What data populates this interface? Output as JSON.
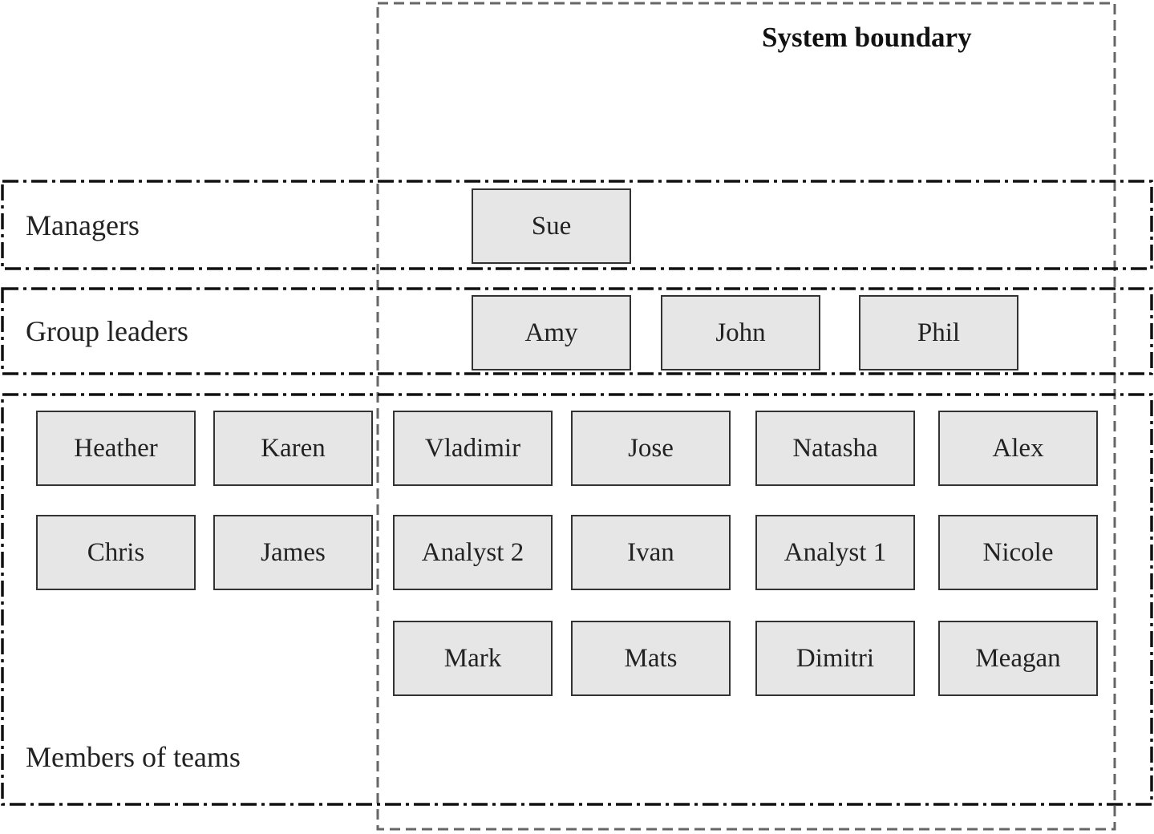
{
  "system_boundary": {
    "label": "System boundary",
    "line_color": "#666666"
  },
  "bands": [
    {
      "label": "Managers"
    },
    {
      "label": "Group leaders"
    },
    {
      "label": "Members of teams"
    }
  ],
  "managers": [
    "Sue"
  ],
  "group_leaders": [
    "Amy",
    "John",
    "Phil"
  ],
  "team_members_outside": [
    [
      "Heather",
      "Karen"
    ],
    [
      "Chris",
      "James"
    ]
  ],
  "team_members_inside": [
    [
      "Vladimir",
      "Jose",
      "Natasha",
      "Alex"
    ],
    [
      "Analyst 2",
      "Ivan",
      "Analyst 1",
      "Nicole"
    ],
    [
      "Mark",
      "Mats",
      "Dimitri",
      "Meagan"
    ]
  ],
  "colors": {
    "box_fill": "#e6e6e6",
    "box_border": "#333333",
    "band_line": "#111111"
  }
}
